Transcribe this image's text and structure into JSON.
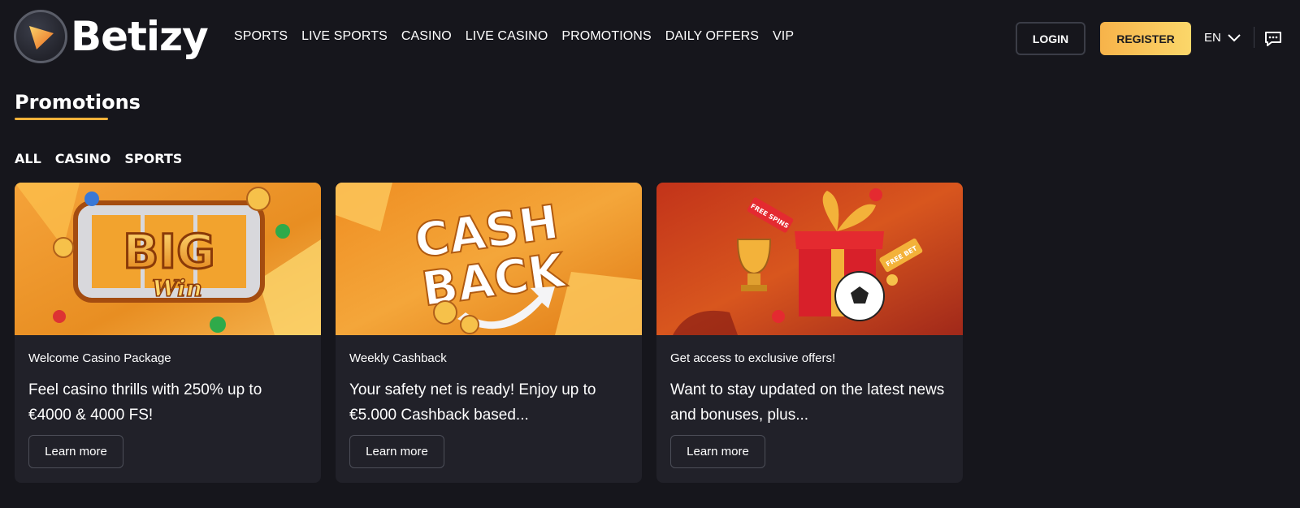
{
  "brand": {
    "name": "Betizy"
  },
  "nav": [
    "SPORTS",
    "LIVE SPORTS",
    "CASINO",
    "LIVE CASINO",
    "PROMOTIONS",
    "DAILY OFFERS",
    "VIP"
  ],
  "header": {
    "login": "LOGIN",
    "register": "REGISTER",
    "language": "EN"
  },
  "page": {
    "title": "Promotions"
  },
  "filters": [
    "ALL",
    "CASINO",
    "SPORTS"
  ],
  "cards": [
    {
      "category": "Welcome Casino Package",
      "text": "Feel casino thrills with 250% up to €4000 & 4000 FS!",
      "button": "Learn more",
      "banner_text": [
        "BIG",
        "Win"
      ]
    },
    {
      "category": "Weekly Cashback",
      "text": "Your safety net is ready! Enjoy up to €5.000 Cashback based...",
      "button": "Learn more",
      "banner_text": [
        "CASH",
        "BACK"
      ]
    },
    {
      "category": "Get access to exclusive offers!",
      "text": "Want to stay updated on the latest news and bonuses, plus...",
      "button": "Learn more",
      "banner_text": [
        "FREE SPINS",
        "FREE BET"
      ]
    }
  ],
  "colors": {
    "background": "#16161c",
    "card": "#212129",
    "accent": "#f3b23a"
  }
}
